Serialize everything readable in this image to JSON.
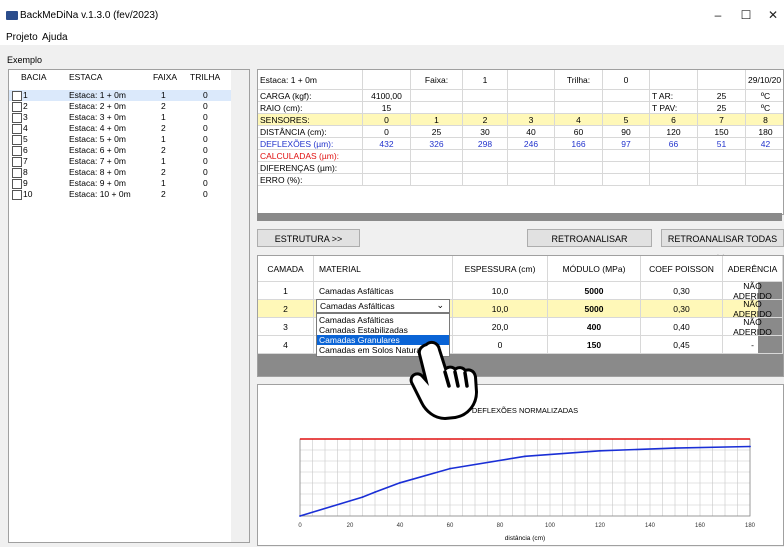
{
  "window": {
    "title": "BackMeDiNa v.1.3.0 (fev/2023)",
    "min": "–",
    "max": "☐",
    "close": "✕"
  },
  "menu": {
    "items": [
      "Projeto",
      "Ajuda"
    ]
  },
  "project_label": "Exemplo",
  "bacia_table": {
    "headers": [
      "BACIA",
      "ESTACA",
      "FAIXA",
      "TRILHA"
    ],
    "rows": [
      {
        "bacia": "1",
        "estaca": "Estaca: 1 + 0m",
        "faixa": "1",
        "trilha": "0"
      },
      {
        "bacia": "2",
        "estaca": "Estaca: 2 + 0m",
        "faixa": "2",
        "trilha": "0"
      },
      {
        "bacia": "3",
        "estaca": "Estaca: 3 + 0m",
        "faixa": "1",
        "trilha": "0"
      },
      {
        "bacia": "4",
        "estaca": "Estaca: 4 + 0m",
        "faixa": "2",
        "trilha": "0"
      },
      {
        "bacia": "5",
        "estaca": "Estaca: 5 + 0m",
        "faixa": "1",
        "trilha": "0"
      },
      {
        "bacia": "6",
        "estaca": "Estaca: 6 + 0m",
        "faixa": "2",
        "trilha": "0"
      },
      {
        "bacia": "7",
        "estaca": "Estaca: 7 + 0m",
        "faixa": "1",
        "trilha": "0"
      },
      {
        "bacia": "8",
        "estaca": "Estaca: 8 + 0m",
        "faixa": "2",
        "trilha": "0"
      },
      {
        "bacia": "9",
        "estaca": "Estaca: 9 + 0m",
        "faixa": "1",
        "trilha": "0"
      },
      {
        "bacia": "10",
        "estaca": "Estaca: 10 + 0m",
        "faixa": "2",
        "trilha": "0"
      }
    ]
  },
  "deflection_grid": {
    "header": {
      "estaca": "Estaca: 1 + 0m",
      "faixa_label": "Faixa:",
      "faixa": "1",
      "trilha_label": "Trilha:",
      "trilha": "0",
      "date": "29/10/20"
    },
    "carga_label": "CARGA (kgf):",
    "carga": "4100,00",
    "tar_label": "T AR:",
    "tar": "25",
    "tar_unit": "ºC",
    "raio_label": "RAIO (cm):",
    "raio": "15",
    "tpav_label": "T PAV:",
    "tpav": "25",
    "tpav_unit": "ºC",
    "sensores_label": "SENSORES:",
    "sensores": [
      "0",
      "1",
      "2",
      "3",
      "4",
      "5",
      "6",
      "7",
      "8"
    ],
    "distancia_label": "DISTÂNCIA (cm):",
    "distancias": [
      "0",
      "25",
      "30",
      "40",
      "60",
      "90",
      "120",
      "150",
      "180"
    ],
    "deflexoes_label": "DEFLEXÕES (µm):",
    "deflexoes": [
      "432",
      "326",
      "298",
      "246",
      "166",
      "97",
      "66",
      "51",
      "42"
    ],
    "calculadas_label": "CALCULADAS (µm):",
    "diferencas_label": "DIFERENÇAS (µm):",
    "erro_label": "ERRO (%):"
  },
  "buttons": {
    "estrutura": "ESTRUTURA >>",
    "retroanalisar": "RETROANALISAR",
    "retroanalisar_todas": "RETROANALISAR TODAS >>"
  },
  "layers": {
    "headers": [
      "CAMADA",
      "MATERIAL",
      "ESPESSURA (cm)",
      "MÓDULO (MPa)",
      "COEF POISSON",
      "ADERÊNCIA"
    ],
    "rows": [
      {
        "camada": "1",
        "material": "Camadas Asfálticas",
        "espessura": "10,0",
        "modulo": "5000",
        "poisson": "0,30",
        "aderencia": "NÃO ADERIDO"
      },
      {
        "camada": "2",
        "material": "Camadas Asfálticas",
        "espessura": "10,0",
        "modulo": "5000",
        "poisson": "0,30",
        "aderencia": "NÃO ADERIDO"
      },
      {
        "camada": "3",
        "material": "",
        "espessura": "20,0",
        "modulo": "400",
        "poisson": "0,40",
        "aderencia": "NÃO ADERIDO"
      },
      {
        "camada": "4",
        "material": "",
        "espessura": "0",
        "modulo": "150",
        "poisson": "0,45",
        "aderencia": "-"
      }
    ],
    "dropdown": {
      "value": "Camadas Asfálticas",
      "options": [
        "Camadas Asfálticas",
        "Camadas Estabilizadas",
        "Camadas Granulares",
        "Camadas em Solos Naturais"
      ],
      "selected_index": 2
    }
  },
  "chart_data": {
    "type": "line",
    "title": "DEFLEXÕES NORMALIZADAS",
    "xlabel": "distância (cm)",
    "ylabel": "",
    "xlim": [
      0,
      180
    ],
    "ylim": [
      -1,
      0
    ],
    "x_ticks": [
      "0",
      "20",
      "40",
      "60",
      "80",
      "100",
      "120",
      "140",
      "160",
      "180"
    ],
    "series": [
      {
        "color": "#1a2fd6",
        "x": [
          0,
          25,
          30,
          40,
          60,
          90,
          120,
          150,
          180
        ],
        "y": [
          -1.0,
          -0.755,
          -0.69,
          -0.569,
          -0.384,
          -0.225,
          -0.153,
          -0.118,
          -0.097
        ]
      }
    ],
    "top_line_color": "#e01010",
    "grid": true
  },
  "colors": {
    "sensor_row": "#fff8b8",
    "deflexoes_text": "#2233cc",
    "calculadas_text": "#e01010",
    "selection": "#0a64d6"
  }
}
